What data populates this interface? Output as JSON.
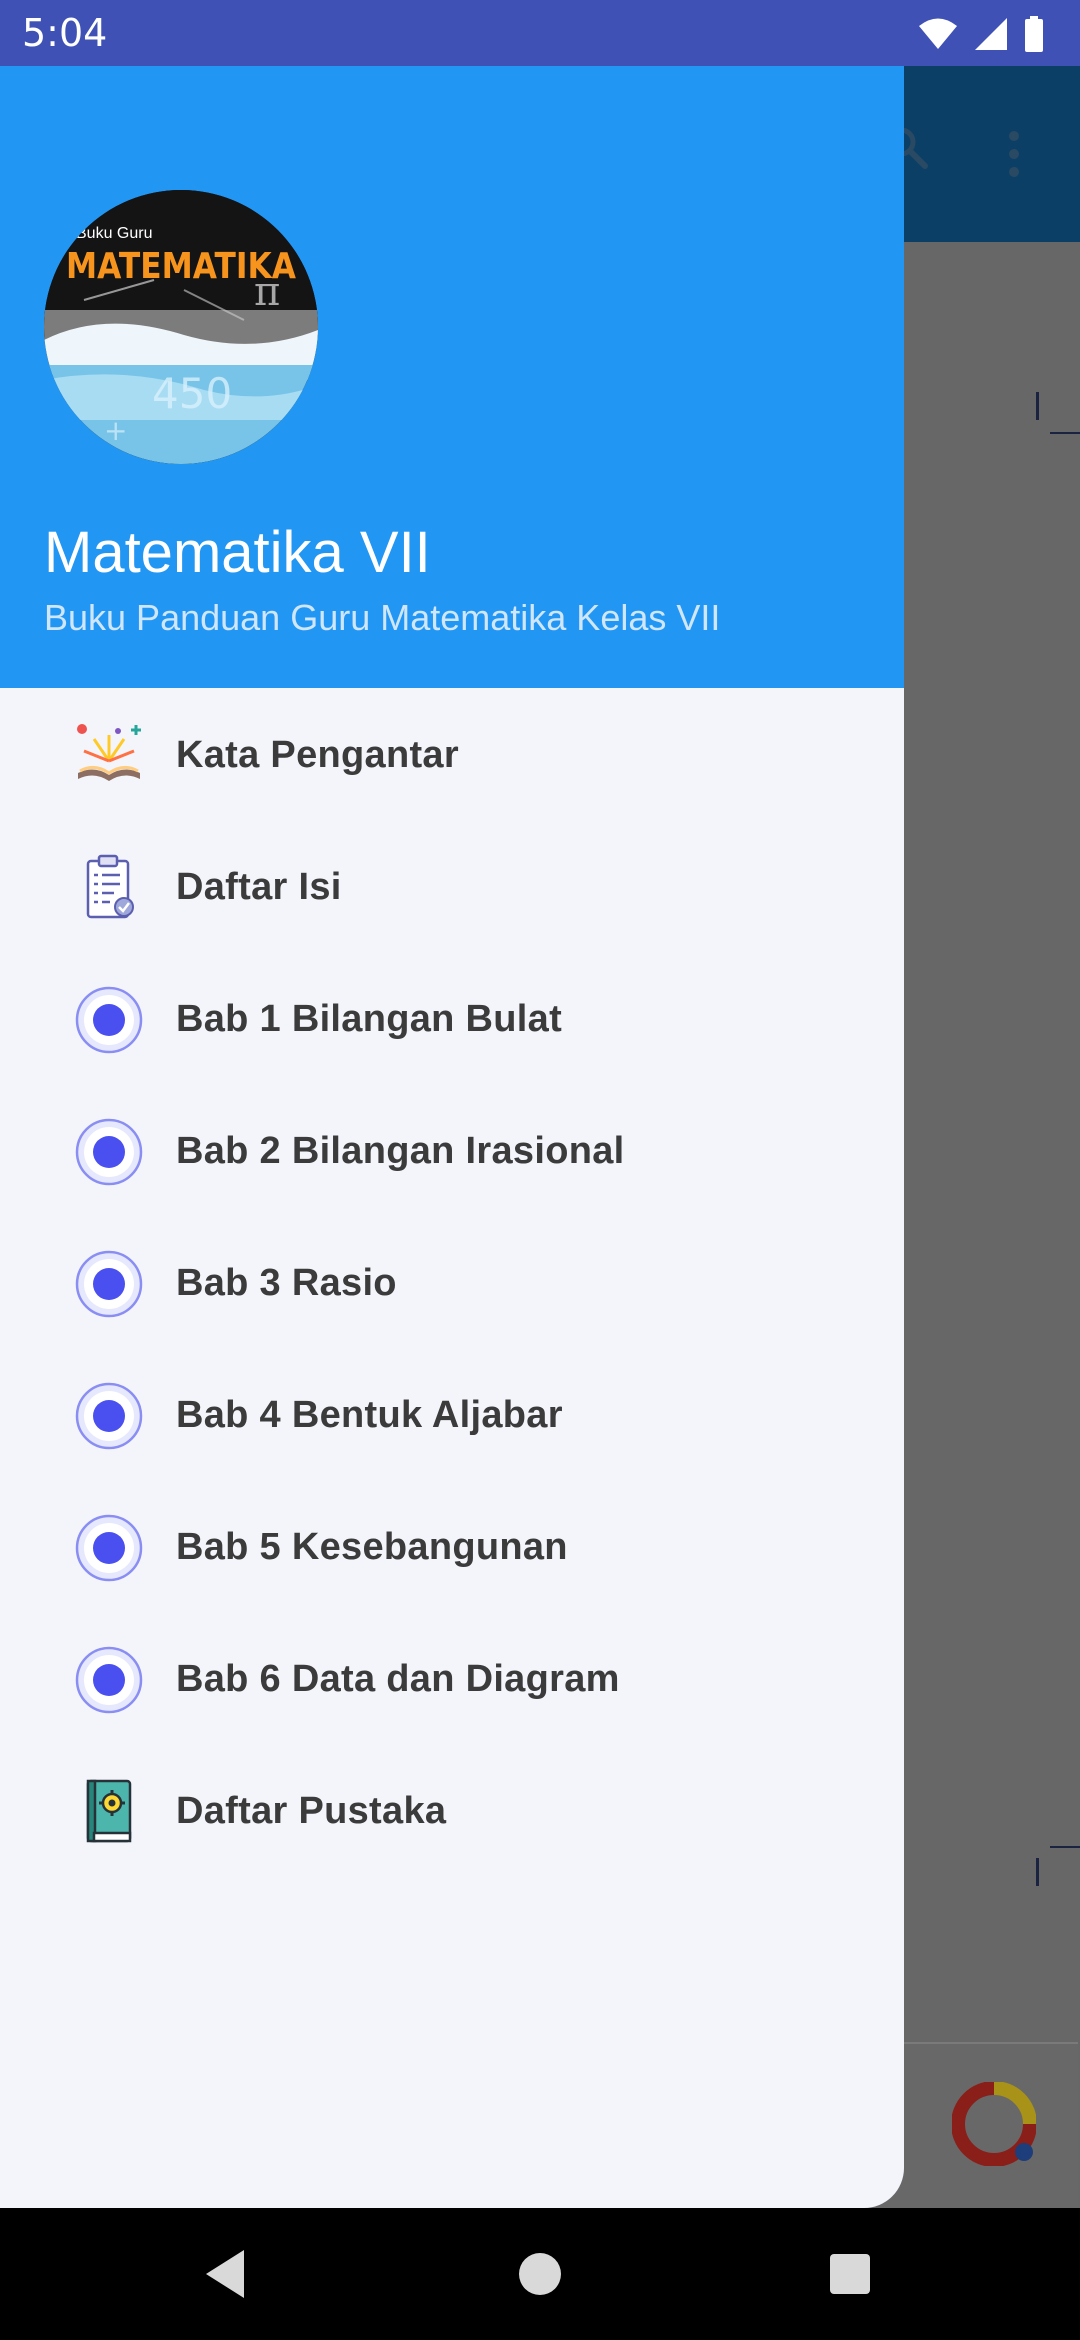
{
  "status_bar": {
    "time": "5:04",
    "icons": [
      "wifi-icon",
      "cellular-signal-icon",
      "battery-icon"
    ]
  },
  "background_app": {
    "icons": [
      "search-icon",
      "more-vert-icon",
      "ad-logo-icon"
    ]
  },
  "drawer": {
    "header": {
      "avatar_text_small": "Buku Guru",
      "avatar_text_big": "MATEMATIKA",
      "title": "Matematika VII",
      "subtitle": "Buku Panduan Guru Matematika Kelas VII",
      "background_color": "#2196f3"
    },
    "items": [
      {
        "label": "Kata Pengantar",
        "icon": "open-book-sparkle-icon"
      },
      {
        "label": "Daftar Isi",
        "icon": "clipboard-checklist-icon"
      },
      {
        "label": "Bab 1 Bilangan Bulat",
        "icon": "radio-dot-icon"
      },
      {
        "label": "Bab 2 Bilangan Irasional",
        "icon": "radio-dot-icon"
      },
      {
        "label": "Bab 3 Rasio",
        "icon": "radio-dot-icon"
      },
      {
        "label": "Bab 4 Bentuk Aljabar",
        "icon": "radio-dot-icon"
      },
      {
        "label": "Bab 5 Kesebangunan",
        "icon": "radio-dot-icon"
      },
      {
        "label": "Bab 6 Data dan Diagram",
        "icon": "radio-dot-icon"
      },
      {
        "label": "Daftar Pustaka",
        "icon": "gear-book-icon"
      }
    ]
  },
  "nav_bar": {
    "buttons": [
      "back-icon",
      "home-icon",
      "recents-icon"
    ]
  },
  "colors": {
    "status_bar": "#3f51b5",
    "drawer_header": "#2196f3",
    "drawer_body": "#f3f5fb",
    "radio_dot": "#4a4ff0",
    "scrim": "#676767"
  }
}
